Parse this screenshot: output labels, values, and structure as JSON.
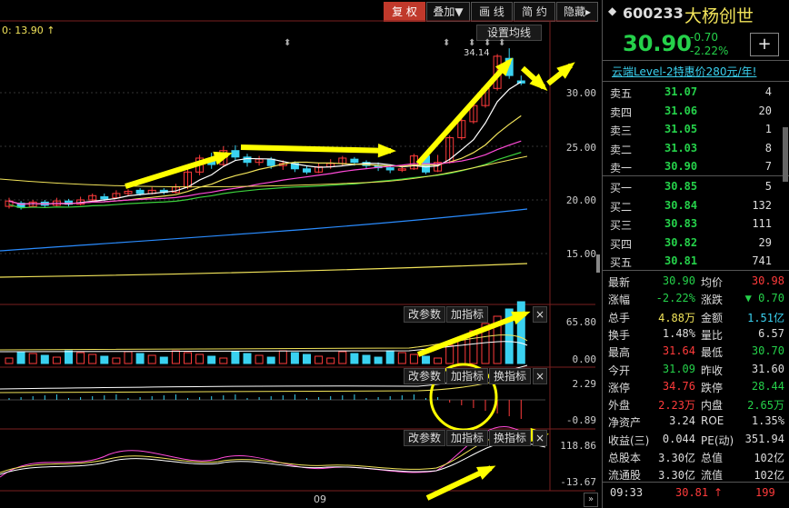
{
  "toolbar": {
    "buttons": [
      {
        "label": "复 权",
        "active": true
      },
      {
        "label": "叠加▼",
        "active": false
      },
      {
        "label": "画 线",
        "active": false
      },
      {
        "label": "简 约",
        "active": false
      },
      {
        "label": "隐藏▸",
        "active": false
      }
    ]
  },
  "chart": {
    "ma_label": "0: 13.90 ↑",
    "setting_button": "设置均线",
    "high_label": "34.14",
    "price_axis": [
      "30.00",
      "25.00",
      "20.00",
      "15.00"
    ],
    "x_axis_label": "09",
    "sub_panels": [
      {
        "buttons": [
          "改参数",
          "加指标"
        ],
        "axis": [
          "65.80",
          "0.00"
        ]
      },
      {
        "buttons": [
          "改参数",
          "加指标",
          "换指标"
        ],
        "axis": [
          "2.29",
          "-0.89"
        ]
      },
      {
        "buttons": [
          "改参数",
          "加指标",
          "换指标"
        ],
        "axis": [
          "118.86",
          "-13.67"
        ]
      }
    ]
  },
  "stock": {
    "code": "600233",
    "name": "大杨创世",
    "price": "30.90",
    "change": "-0.70",
    "change_pct": "-2.22%",
    "add_button": "+"
  },
  "promo": "云端Level-2特惠价280元/年!",
  "asks": [
    {
      "label": "卖五",
      "price": "31.07",
      "vol": "4"
    },
    {
      "label": "卖四",
      "price": "31.06",
      "vol": "20"
    },
    {
      "label": "卖三",
      "price": "31.05",
      "vol": "1"
    },
    {
      "label": "卖二",
      "price": "31.03",
      "vol": "8"
    },
    {
      "label": "卖一",
      "price": "30.90",
      "vol": "7"
    }
  ],
  "bids": [
    {
      "label": "买一",
      "price": "30.85",
      "vol": "5"
    },
    {
      "label": "买二",
      "price": "30.84",
      "vol": "132"
    },
    {
      "label": "买三",
      "price": "30.83",
      "vol": "111"
    },
    {
      "label": "买四",
      "price": "30.82",
      "vol": "29"
    },
    {
      "label": "买五",
      "price": "30.81",
      "vol": "741"
    }
  ],
  "stats": [
    {
      "l1": "最新",
      "v1": "30.90",
      "c1": "green",
      "l2": "均价",
      "v2": "30.98",
      "c2": "red"
    },
    {
      "l1": "涨幅",
      "v1": "-2.22%",
      "c1": "green",
      "l2": "涨跌",
      "v2": "▼ 0.70",
      "c2": "green"
    },
    {
      "l1": "总手",
      "v1": "4.88万",
      "c1": "yellow",
      "l2": "金额",
      "v2": "1.51亿",
      "c2": "cyan"
    },
    {
      "l1": "换手",
      "v1": "1.48%",
      "c1": "white",
      "l2": "量比",
      "v2": "6.57",
      "c2": "white"
    },
    {
      "l1": "最高",
      "v1": "31.64",
      "c1": "red",
      "l2": "最低",
      "v2": "30.70",
      "c2": "green"
    },
    {
      "l1": "今开",
      "v1": "31.09",
      "c1": "green",
      "l2": "昨收",
      "v2": "31.60",
      "c2": "white"
    },
    {
      "l1": "涨停",
      "v1": "34.76",
      "c1": "red",
      "l2": "跌停",
      "v2": "28.44",
      "c2": "green"
    },
    {
      "l1": "外盘",
      "v1": "2.23万",
      "c1": "red",
      "l2": "内盘",
      "v2": "2.65万",
      "c2": "green"
    },
    {
      "l1": "净资产",
      "v1": "3.24",
      "c1": "white",
      "l2": "ROE",
      "v2": "1.35%",
      "c2": "white"
    },
    {
      "l1": "收益(三)",
      "v1": "0.044",
      "c1": "white",
      "l2": "PE(动)",
      "v2": "351.94",
      "c2": "white"
    },
    {
      "l1": "总股本",
      "v1": "3.30亿",
      "c1": "white",
      "l2": "总值",
      "v2": "102亿",
      "c2": "white"
    },
    {
      "l1": "流通股",
      "v1": "3.30亿",
      "c1": "white",
      "l2": "流值",
      "v2": "102亿",
      "c2": "white"
    }
  ],
  "tick": {
    "time": "09:33",
    "price": "30.81",
    "arrow": "↑",
    "vol": "199"
  },
  "candles": [
    {
      "o": 19.4,
      "c": 19.9,
      "h": 20.2,
      "l": 19.2
    },
    {
      "o": 19.7,
      "c": 19.3,
      "h": 19.9,
      "l": 19.1
    },
    {
      "o": 19.4,
      "c": 19.8,
      "h": 20.0,
      "l": 19.3
    },
    {
      "o": 19.8,
      "c": 19.5,
      "h": 20.0,
      "l": 19.3
    },
    {
      "o": 19.5,
      "c": 19.9,
      "h": 20.2,
      "l": 19.4
    },
    {
      "o": 19.9,
      "c": 19.6,
      "h": 20.1,
      "l": 19.4
    },
    {
      "o": 19.6,
      "c": 20.0,
      "h": 20.3,
      "l": 19.5
    },
    {
      "o": 20.0,
      "c": 20.4,
      "h": 20.6,
      "l": 19.9
    },
    {
      "o": 20.3,
      "c": 20.1,
      "h": 20.6,
      "l": 19.9
    },
    {
      "o": 20.2,
      "c": 20.6,
      "h": 20.9,
      "l": 20.1
    },
    {
      "o": 20.6,
      "c": 20.8,
      "h": 21.0,
      "l": 20.4
    },
    {
      "o": 20.9,
      "c": 20.6,
      "h": 21.1,
      "l": 20.4
    },
    {
      "o": 20.6,
      "c": 20.9,
      "h": 21.2,
      "l": 20.5
    },
    {
      "o": 20.9,
      "c": 20.7,
      "h": 21.1,
      "l": 20.5
    },
    {
      "o": 20.7,
      "c": 21.2,
      "h": 21.5,
      "l": 20.6
    },
    {
      "o": 21.2,
      "c": 22.6,
      "h": 22.9,
      "l": 21.0
    },
    {
      "o": 22.6,
      "c": 23.9,
      "h": 24.2,
      "l": 22.3
    },
    {
      "o": 23.8,
      "c": 23.3,
      "h": 24.4,
      "l": 22.9
    },
    {
      "o": 23.3,
      "c": 24.6,
      "h": 25.0,
      "l": 23.1
    },
    {
      "o": 24.6,
      "c": 24.0,
      "h": 25.1,
      "l": 23.7
    },
    {
      "o": 24.0,
      "c": 23.5,
      "h": 24.3,
      "l": 23.1
    },
    {
      "o": 23.5,
      "c": 23.8,
      "h": 24.1,
      "l": 23.2
    },
    {
      "o": 23.8,
      "c": 23.2,
      "h": 24.0,
      "l": 22.9
    },
    {
      "o": 23.2,
      "c": 23.4,
      "h": 23.7,
      "l": 22.8
    },
    {
      "o": 23.4,
      "c": 22.9,
      "h": 23.6,
      "l": 22.6
    },
    {
      "o": 22.9,
      "c": 22.6,
      "h": 23.2,
      "l": 22.4
    },
    {
      "o": 22.6,
      "c": 23.1,
      "h": 23.4,
      "l": 22.5
    },
    {
      "o": 23.1,
      "c": 23.4,
      "h": 23.8,
      "l": 22.9
    },
    {
      "o": 23.4,
      "c": 23.9,
      "h": 24.1,
      "l": 23.2
    },
    {
      "o": 23.8,
      "c": 23.5,
      "h": 24.0,
      "l": 23.2
    },
    {
      "o": 23.5,
      "c": 23.2,
      "h": 23.7,
      "l": 22.9
    },
    {
      "o": 23.2,
      "c": 23.0,
      "h": 23.5,
      "l": 22.7
    },
    {
      "o": 23.0,
      "c": 22.8,
      "h": 23.3,
      "l": 22.5
    },
    {
      "o": 22.8,
      "c": 22.9,
      "h": 23.2,
      "l": 22.6
    },
    {
      "o": 22.9,
      "c": 24.1,
      "h": 24.3,
      "l": 22.8
    },
    {
      "o": 24.1,
      "c": 22.6,
      "h": 24.3,
      "l": 22.4
    },
    {
      "o": 22.7,
      "c": 23.5,
      "h": 24.2,
      "l": 22.6
    },
    {
      "o": 23.5,
      "c": 25.8,
      "h": 26.0,
      "l": 23.4
    },
    {
      "o": 25.8,
      "c": 27.4,
      "h": 27.7,
      "l": 25.6
    },
    {
      "o": 27.3,
      "c": 28.8,
      "h": 29.0,
      "l": 27.1
    },
    {
      "o": 28.8,
      "c": 30.4,
      "h": 30.6,
      "l": 28.6
    },
    {
      "o": 30.4,
      "c": 33.4,
      "h": 33.6,
      "l": 30.2
    },
    {
      "o": 33.2,
      "c": 31.6,
      "h": 34.14,
      "l": 31.3
    },
    {
      "o": 31.1,
      "c": 30.9,
      "h": 31.6,
      "l": 30.7
    }
  ],
  "colors": {
    "up": "#ff3b3b",
    "down": "#3ad1f0",
    "arrow": "#ffff00",
    "active": "#c0392b"
  }
}
